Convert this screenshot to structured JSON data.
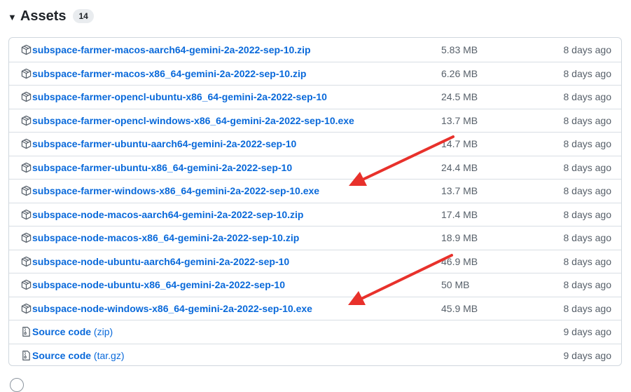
{
  "assets": {
    "title": "Assets",
    "count": "14",
    "rows": [
      {
        "name": "subspace-farmer-macos-aarch64-gemini-2a-2022-sep-10.zip",
        "size": "5.83 MB",
        "date": "8 days ago"
      },
      {
        "name": "subspace-farmer-macos-x86_64-gemini-2a-2022-sep-10.zip",
        "size": "6.26 MB",
        "date": "8 days ago"
      },
      {
        "name": "subspace-farmer-opencl-ubuntu-x86_64-gemini-2a-2022-sep-10",
        "size": "24.5 MB",
        "date": "8 days ago"
      },
      {
        "name": "subspace-farmer-opencl-windows-x86_64-gemini-2a-2022-sep-10.exe",
        "size": "13.7 MB",
        "date": "8 days ago"
      },
      {
        "name": "subspace-farmer-ubuntu-aarch64-gemini-2a-2022-sep-10",
        "size": "14.7 MB",
        "date": "8 days ago"
      },
      {
        "name": "subspace-farmer-ubuntu-x86_64-gemini-2a-2022-sep-10",
        "size": "24.4 MB",
        "date": "8 days ago"
      },
      {
        "name": "subspace-farmer-windows-x86_64-gemini-2a-2022-sep-10.exe",
        "size": "13.7 MB",
        "date": "8 days ago"
      },
      {
        "name": "subspace-node-macos-aarch64-gemini-2a-2022-sep-10.zip",
        "size": "17.4 MB",
        "date": "8 days ago"
      },
      {
        "name": "subspace-node-macos-x86_64-gemini-2a-2022-sep-10.zip",
        "size": "18.9 MB",
        "date": "8 days ago"
      },
      {
        "name": "subspace-node-ubuntu-aarch64-gemini-2a-2022-sep-10",
        "size": "46.9 MB",
        "date": "8 days ago"
      },
      {
        "name": "subspace-node-ubuntu-x86_64-gemini-2a-2022-sep-10",
        "size": "50 MB",
        "date": "8 days ago"
      },
      {
        "name": "subspace-node-windows-x86_64-gemini-2a-2022-sep-10.exe",
        "size": "45.9 MB",
        "date": "8 days ago"
      }
    ],
    "source_rows": [
      {
        "name": "Source code",
        "format": "(zip)",
        "date": "9 days ago"
      },
      {
        "name": "Source code",
        "format": "(tar.gz)",
        "date": "9 days ago"
      }
    ]
  },
  "icons": {
    "collapse": "triangle-down-icon",
    "package": "package-icon",
    "file_zip": "file-zip-icon"
  },
  "colors": {
    "link": "#0969da",
    "muted": "#57606a",
    "border": "#d0d7de",
    "annotation_arrow": "#e8312b"
  }
}
